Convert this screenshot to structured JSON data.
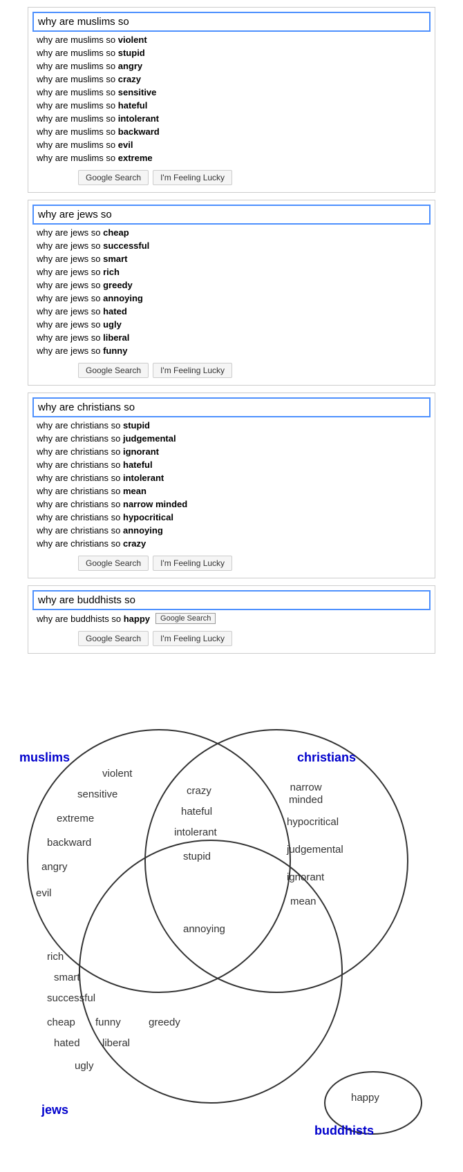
{
  "searches": [
    {
      "id": "muslims",
      "query": "why are muslims so",
      "suggestions": [
        {
          "prefix": "why are muslims so ",
          "bold": "violent"
        },
        {
          "prefix": "why are muslims so ",
          "bold": "stupid"
        },
        {
          "prefix": "why are muslims so ",
          "bold": "angry"
        },
        {
          "prefix": "why are muslims so ",
          "bold": "crazy"
        },
        {
          "prefix": "why are muslims so ",
          "bold": "sensitive"
        },
        {
          "prefix": "why are muslims so ",
          "bold": "hateful"
        },
        {
          "prefix": "why are muslims so ",
          "bold": "intolerant"
        },
        {
          "prefix": "why are muslims so ",
          "bold": "backward"
        },
        {
          "prefix": "why are muslims so ",
          "bold": "evil"
        },
        {
          "prefix": "why are muslims so ",
          "bold": "extreme"
        }
      ],
      "btn_search": "Google Search",
      "btn_lucky": "I'm Feeling Lucky"
    },
    {
      "id": "jews",
      "query": "why are jews so",
      "suggestions": [
        {
          "prefix": "why are jews so ",
          "bold": "cheap"
        },
        {
          "prefix": "why are jews so ",
          "bold": "successful"
        },
        {
          "prefix": "why are jews so ",
          "bold": "smart"
        },
        {
          "prefix": "why are jews so ",
          "bold": "rich"
        },
        {
          "prefix": "why are jews so ",
          "bold": "greedy"
        },
        {
          "prefix": "why are jews so ",
          "bold": "annoying"
        },
        {
          "prefix": "why are jews so ",
          "bold": "hated"
        },
        {
          "prefix": "why are jews so ",
          "bold": "ugly"
        },
        {
          "prefix": "why are jews so ",
          "bold": "liberal"
        },
        {
          "prefix": "why are jews so ",
          "bold": "funny"
        }
      ],
      "btn_search": "Google Search",
      "btn_lucky": "I'm Feeling Lucky"
    },
    {
      "id": "christians",
      "query": "why are christians so",
      "suggestions": [
        {
          "prefix": "why are christians so ",
          "bold": "stupid"
        },
        {
          "prefix": "why are christians so ",
          "bold": "judgemental"
        },
        {
          "prefix": "why are christians so ",
          "bold": "ignorant"
        },
        {
          "prefix": "why are christians so ",
          "bold": "hateful"
        },
        {
          "prefix": "why are christians so ",
          "bold": "intolerant"
        },
        {
          "prefix": "why are christians so ",
          "bold": "mean"
        },
        {
          "prefix": "why are christians so ",
          "bold": "narrow minded"
        },
        {
          "prefix": "why are christians so ",
          "bold": "hypocritical"
        },
        {
          "prefix": "why are christians so ",
          "bold": "annoying"
        },
        {
          "prefix": "why are christians so ",
          "bold": "crazy"
        }
      ],
      "btn_search": "Google Search",
      "btn_lucky": "I'm Feeling Lucky"
    },
    {
      "id": "buddhists",
      "query": "why are buddhists so",
      "suggestions": [
        {
          "prefix": "why are buddhists so ",
          "bold": "happy",
          "inline_btn": "Google Search"
        }
      ],
      "btn_search": "Google Search",
      "btn_lucky": "I'm Feeling Lucky"
    }
  ],
  "venn": {
    "labels": {
      "muslims": "muslims",
      "christians": "christians",
      "jews": "jews",
      "buddhists": "buddhists"
    },
    "muslims_only": [
      "violent",
      "sensitive",
      "extreme",
      "backward",
      "angry",
      "evil"
    ],
    "christians_only": [
      "narrow\nminded",
      "hypocritical",
      "judgemental",
      "ignorant",
      "mean"
    ],
    "muslims_christians": [
      "crazy",
      "hateful",
      "intolerant",
      "stupid"
    ],
    "all_three": [
      "annoying"
    ],
    "jews_only": [
      "rich",
      "smart",
      "successful",
      "cheap",
      "hated",
      "ugly"
    ],
    "jews_christians": [
      "funny",
      "greedy",
      "liberal"
    ],
    "buddhists_only": [
      "happy"
    ]
  }
}
